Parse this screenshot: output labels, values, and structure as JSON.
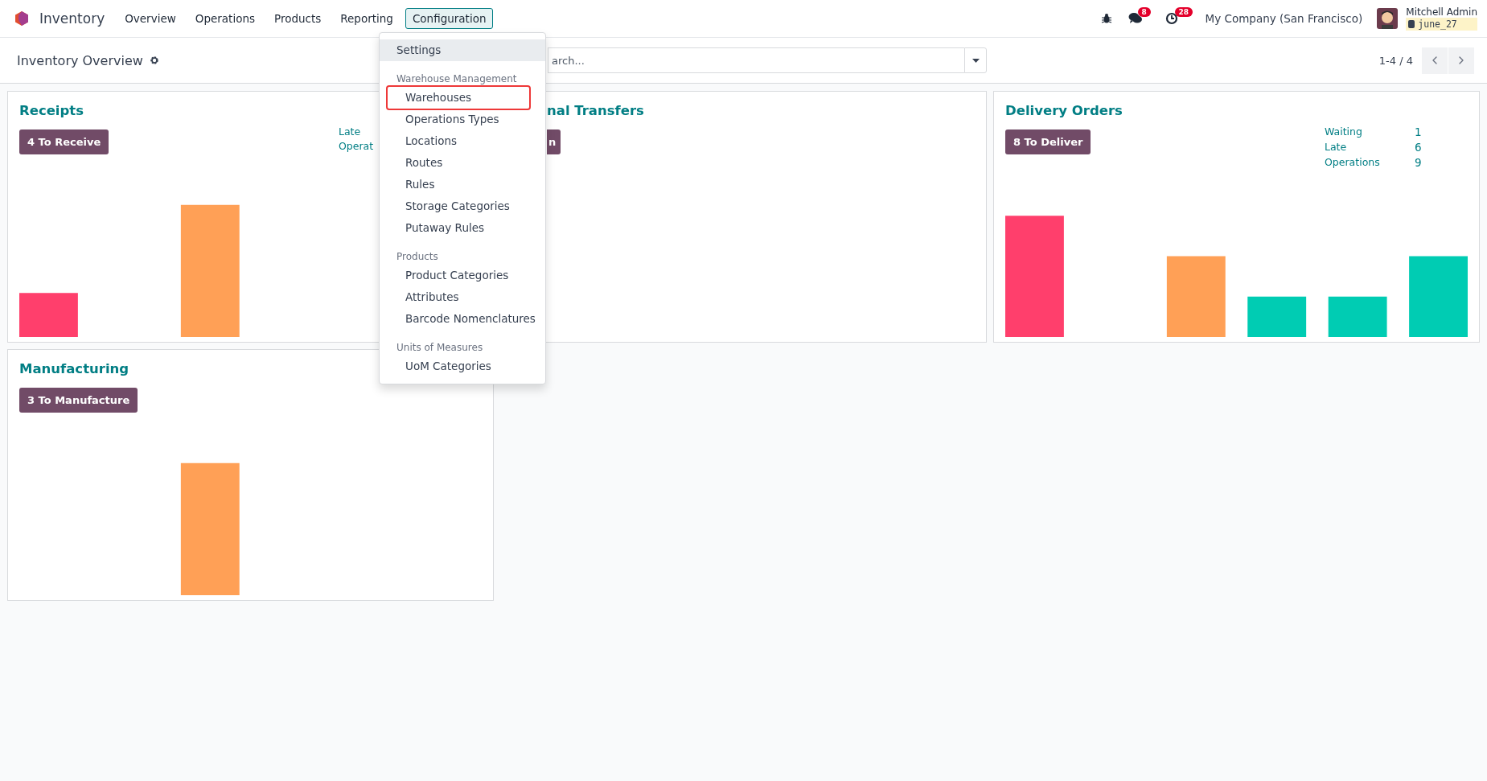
{
  "navbar": {
    "app_name": "Inventory",
    "menu": [
      {
        "label": "Overview",
        "selected": false
      },
      {
        "label": "Operations",
        "selected": false
      },
      {
        "label": "Products",
        "selected": false
      },
      {
        "label": "Reporting",
        "selected": false
      },
      {
        "label": "Configuration",
        "selected": true
      }
    ],
    "messages_count": "8",
    "activities_count": "28",
    "company": "My Company (San Francisco)",
    "user_name": "Mitchell Admin",
    "database": "june_27"
  },
  "control_panel": {
    "title": "Inventory Overview",
    "search": {
      "placeholder": "arch..."
    },
    "pager": "1-4 / 4"
  },
  "cards": [
    {
      "kind": "full",
      "title": "Receipts",
      "button": "4 To Receive",
      "stats": [
        {
          "label": "Late"
        },
        {
          "label": "Operat"
        }
      ]
    },
    {
      "kind": "cut",
      "title": "nal Transfers",
      "button": "n"
    },
    {
      "kind": "full",
      "title": "Delivery Orders",
      "button": "8 To Deliver",
      "stats": [
        {
          "label": "Waiting",
          "value": "1"
        },
        {
          "label": "Late",
          "value": "6"
        },
        {
          "label": "Operations",
          "value": "9"
        }
      ]
    },
    {
      "kind": "full",
      "title": "Manufacturing",
      "button": "3 To Manufacture"
    }
  ],
  "dropdown": {
    "sections": [
      {
        "items": [
          {
            "label": "Settings",
            "active": true,
            "highlighted": false
          }
        ]
      },
      {
        "heading": "Warehouse Management",
        "items": [
          {
            "label": "Warehouses",
            "active": false,
            "highlighted": true
          },
          {
            "label": "Operations Types",
            "active": false,
            "highlighted": false
          },
          {
            "label": "Locations",
            "active": false,
            "highlighted": false
          },
          {
            "label": "Routes",
            "active": false,
            "highlighted": false
          },
          {
            "label": "Rules",
            "active": false,
            "highlighted": false
          },
          {
            "label": "Storage Categories",
            "active": false,
            "highlighted": false
          },
          {
            "label": "Putaway Rules",
            "active": false,
            "highlighted": false
          }
        ]
      },
      {
        "heading": "Products",
        "items": [
          {
            "label": "Product Categories",
            "active": false,
            "highlighted": false
          },
          {
            "label": "Attributes",
            "active": false,
            "highlighted": false
          },
          {
            "label": "Barcode Nomenclatures",
            "active": false,
            "highlighted": false
          }
        ]
      },
      {
        "heading": "Units of Measures",
        "items": [
          {
            "label": "UoM Categories",
            "active": false,
            "highlighted": false
          }
        ]
      }
    ]
  }
}
